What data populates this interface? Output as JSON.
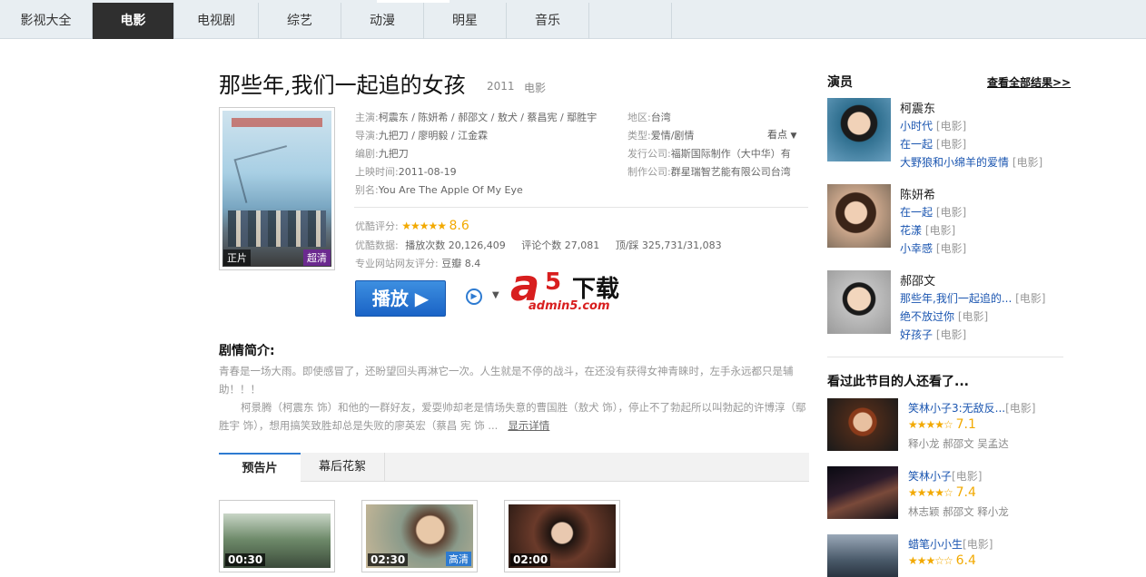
{
  "nav": {
    "tabs": [
      "影视大全",
      "电影",
      "电视剧",
      "综艺",
      "动漫",
      "明星",
      "音乐"
    ],
    "active_index": 1
  },
  "movie": {
    "title": "那些年,我们一起追的女孩",
    "year": "2011",
    "category": "电影",
    "poster_badge_left": "正片",
    "poster_badge_right": "超清",
    "cast_label": "主演:",
    "cast": "柯震东 / 陈妍希 / 郝邵文 / 敖犬 / 蔡昌宪 / 鄢胜宇",
    "director_label": "导演:",
    "director": "九把刀 / 廖明毅 / 江金霖",
    "writer_label": "编剧:",
    "writer": "九把刀",
    "release_label": "上映时间:",
    "release": "2011-08-19",
    "alias_label": "别名:",
    "alias": "You Are The Apple Of My Eye",
    "region_label": "地区:",
    "region": "台湾",
    "genre_label": "类型:",
    "genre": "爱情/剧情",
    "publisher_label": "发行公司:",
    "publisher": "福斯国际制作（大中华）有",
    "producer_label": "制作公司:",
    "producer": "群星瑞智艺能有限公司台湾",
    "watch_label": "看点",
    "rating_label": "优酷评分:",
    "rating_stars": "★★★★★",
    "rating": "8.6",
    "stats_label": "优酷数据:",
    "plays_label": "播放次数",
    "plays": "20,126,409",
    "comments_label": "评论个数",
    "comments": "27,081",
    "likes_label": "顶/踩",
    "likes": "325,731/31,083",
    "pro_label": "专业网站网友评分:",
    "pro_site": "豆瓣",
    "pro_score": "8.4",
    "play_button": "播放 ▶"
  },
  "watermark": {
    "a": "a",
    "five": "5",
    "text": "下载",
    "url": "admin5.com"
  },
  "synopsis": {
    "title": "剧情简介:",
    "para1": "青春是一场大雨。即使感冒了，还盼望回头再淋它一次。人生就是不停的战斗，在还没有获得女神青睐时，左手永远都只是辅助！！！",
    "para2": "柯景腾（柯震东 饰）和他的一群好友，爱耍帅却老是情场失意的曹国胜（敖犬 饰），停止不了勃起所以叫勃起的许博淳（鄢胜宇 饰），想用搞笑致胜却总是失败的廖英宏（蔡昌 宪 饰 ...",
    "more": "显示详情"
  },
  "subtabs": [
    "预告片",
    "幕后花絮"
  ],
  "trailers": [
    {
      "duration": "00:30",
      "hd": ""
    },
    {
      "duration": "02:30",
      "hd": "高清"
    },
    {
      "duration": "02:00",
      "hd": ""
    }
  ],
  "actors_section": {
    "title": "演员",
    "more": "查看全部结果>>",
    "actors": [
      {
        "name": "柯震东",
        "works": [
          {
            "title": "小时代",
            "type": "[电影]"
          },
          {
            "title": "在一起",
            "type": "[电影]"
          },
          {
            "title": "大野狼和小绵羊的爱情",
            "type": "[电影]"
          }
        ]
      },
      {
        "name": "陈妍希",
        "works": [
          {
            "title": "在一起",
            "type": "[电影]"
          },
          {
            "title": "花漾",
            "type": "[电影]"
          },
          {
            "title": "小幸感",
            "type": "[电影]"
          }
        ]
      },
      {
        "name": "郝邵文",
        "works": [
          {
            "title": "那些年,我们一起追的...",
            "type": "[电影]"
          },
          {
            "title": "绝不放过你",
            "type": "[电影]"
          },
          {
            "title": "好孩子",
            "type": "[电影]"
          }
        ]
      }
    ]
  },
  "also_watched": {
    "title": "看过此节目的人还看了...",
    "items": [
      {
        "title": "笑林小子3:无敌反...",
        "type": "[电影]",
        "stars": "★★★★☆",
        "score": "7.1",
        "cast": "释小龙 郝邵文 吴孟达"
      },
      {
        "title": "笑林小子",
        "type": "[电影]",
        "stars": "★★★★☆",
        "score": "7.4",
        "cast": "林志颖 郝邵文 释小龙"
      },
      {
        "title": "蜡笔小小生",
        "type": "[电影]",
        "stars": "★★★☆☆",
        "score": "6.4",
        "cast": ""
      }
    ]
  }
}
